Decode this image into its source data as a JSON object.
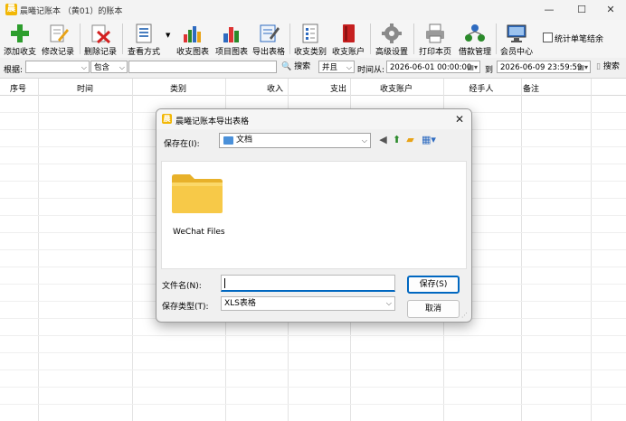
{
  "window": {
    "title": "晨曦记账本  （黄01）的账本",
    "controls": [
      "—",
      "☐",
      "✕"
    ]
  },
  "toolbar": {
    "buttons": [
      {
        "label": "添加收支",
        "icon": "add-icon"
      },
      {
        "label": "修改记录",
        "icon": "edit-icon"
      },
      {
        "label": "删除记录",
        "icon": "delete-icon"
      },
      {
        "label": "查看方式",
        "icon": "view-icon"
      },
      {
        "label": "收支图表",
        "icon": "chart-icon"
      },
      {
        "label": "项目图表",
        "icon": "project-chart-icon"
      },
      {
        "label": "导出表格",
        "icon": "export-icon"
      },
      {
        "label": "收支类别",
        "icon": "category-icon"
      },
      {
        "label": "收支账户",
        "icon": "account-icon"
      },
      {
        "label": "高级设置",
        "icon": "gear-icon"
      },
      {
        "label": "打印本页",
        "icon": "printer-icon"
      },
      {
        "label": "借款管理",
        "icon": "loan-icon"
      },
      {
        "label": "会员中心",
        "icon": "member-icon"
      }
    ],
    "checkbox_label": "统计单笔结余"
  },
  "filter": {
    "basis_label": "根据:",
    "basis_value": "",
    "match_value": "包含",
    "keyword_value": "",
    "search_label": "搜索",
    "logic_value": "并且",
    "time_from_label": "时间从:",
    "time_from_value": "2026-06-01 00:00:00",
    "to_label": "到",
    "time_to_value": "2026-06-09 23:59:59",
    "search2_label": "搜索"
  },
  "table": {
    "columns": [
      "序号",
      "时间",
      "类别",
      "收入",
      "支出",
      "收支账户",
      "经手人",
      "备注"
    ]
  },
  "dialog": {
    "title": "晨曦记账本导出表格",
    "save_in_label": "保存在(I):",
    "save_in_value": "文档",
    "items": [
      {
        "name": "WeChat Files",
        "icon": "folder-icon"
      }
    ],
    "filename_label": "文件名(N):",
    "filename_value": "",
    "filetype_label": "保存类型(T):",
    "filetype_value": "XLS表格",
    "save_button": "保存(S)",
    "cancel_button": "取消",
    "close_glyph": "✕"
  }
}
